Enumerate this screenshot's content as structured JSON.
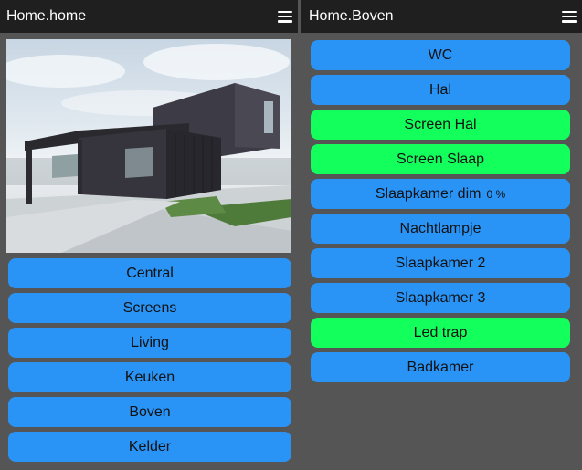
{
  "left": {
    "title": "Home.home",
    "menu_icon": "hamburger-menu-icon",
    "buttons": [
      "Central",
      "Screens",
      "Living",
      "Keuken",
      "Boven",
      "Kelder"
    ]
  },
  "right": {
    "title": "Home.Boven",
    "menu_icon": "hamburger-menu-icon",
    "buttons": [
      {
        "label": "WC",
        "state": "off"
      },
      {
        "label": "Hal",
        "state": "off"
      },
      {
        "label": "Screen Hal",
        "state": "on"
      },
      {
        "label": "Screen Slaap",
        "state": "on"
      },
      {
        "label": "Slaapkamer dim",
        "value": "0 %",
        "state": "off"
      },
      {
        "label": "Nachtlampje",
        "state": "off"
      },
      {
        "label": "Slaapkamer 2",
        "state": "off"
      },
      {
        "label": "Slaapkamer 3",
        "state": "off"
      },
      {
        "label": "Led trap",
        "state": "on"
      },
      {
        "label": "Badkamer",
        "state": "off"
      }
    ]
  },
  "colors": {
    "button_off": "#2a94f6",
    "button_on": "#12ff5c",
    "header_bg": "#1f1f1f",
    "page_bg": "#555555"
  }
}
